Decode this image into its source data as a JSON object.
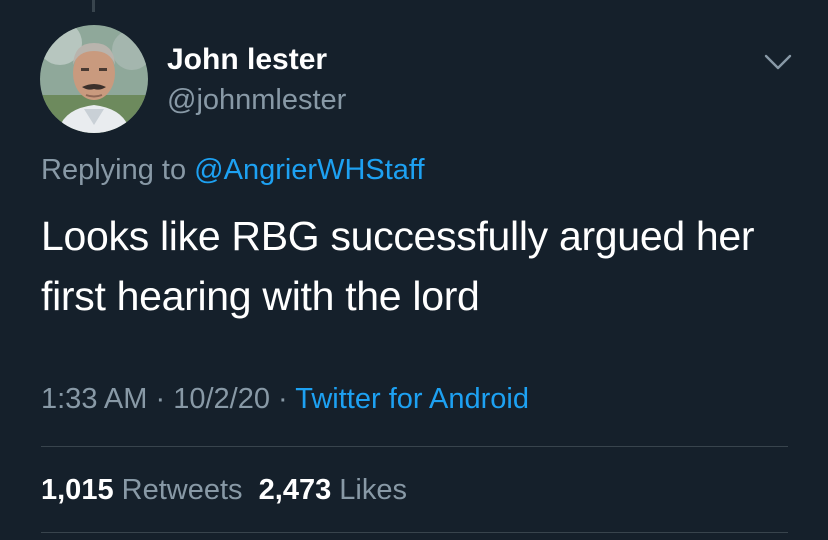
{
  "tweet": {
    "author_name": "John lester",
    "author_handle": "@johnmlester",
    "replying_prefix": "Replying to",
    "replying_to": "@AngrierWHStaff",
    "text": "Looks like RBG successfully argued her first hearing with the lord",
    "time": "1:33 AM",
    "separator": "·",
    "date": "10/2/20",
    "source": "Twitter for Android",
    "retweets_count": "1,015",
    "retweets_label": "Retweets",
    "likes_count": "2,473",
    "likes_label": "Likes"
  },
  "icons": {
    "more": "chevron-down-icon",
    "avatar": "profile-photo"
  },
  "colors": {
    "background": "#15202b",
    "primary_text": "#ffffff",
    "secondary_text": "#8899a6",
    "accent": "#1da1f2",
    "divider": "#38444d"
  }
}
